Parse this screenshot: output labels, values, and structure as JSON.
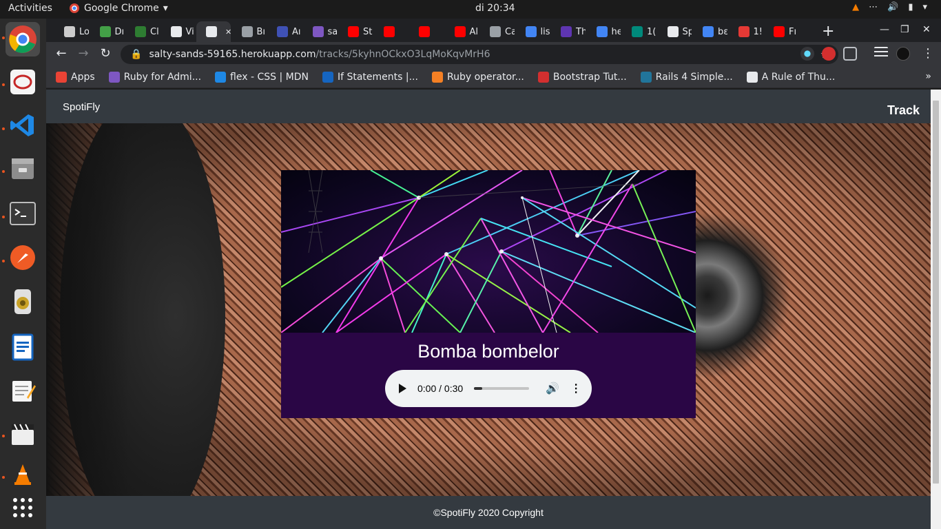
{
  "system": {
    "activities": "Activities",
    "app_name": "Google Chrome",
    "clock": "di 20:34"
  },
  "tabs": [
    {
      "label": "Lo",
      "color": "#cccccc"
    },
    {
      "label": "Dı",
      "color": "#43a047"
    },
    {
      "label": "Cl",
      "color": "#2e7d32"
    },
    {
      "label": "Vi",
      "color": "#e8eaed"
    },
    {
      "label": "",
      "color": "#e8eaed",
      "active": true
    },
    {
      "label": "Bı",
      "color": "#9aa0a6"
    },
    {
      "label": "Aı",
      "color": "#3f51b5"
    },
    {
      "label": "sa",
      "color": "#7e57c2"
    },
    {
      "label": "St",
      "color": "#ff0000"
    },
    {
      "label": "",
      "color": "#ff0000"
    },
    {
      "label": "",
      "color": "#ff0000"
    },
    {
      "label": "Al",
      "color": "#ff0000"
    },
    {
      "label": "Ca",
      "color": "#9aa0a6"
    },
    {
      "label": "lis",
      "color": "#4285f4"
    },
    {
      "label": "Th",
      "color": "#5e35b1"
    },
    {
      "label": "he",
      "color": "#4285f4"
    },
    {
      "label": "1(",
      "color": "#00897b"
    },
    {
      "label": "Sp",
      "color": "#e8eaed"
    },
    {
      "label": "bε",
      "color": "#4285f4"
    },
    {
      "label": "1!",
      "color": "#e53935"
    },
    {
      "label": "Fı",
      "color": "#ff0000"
    }
  ],
  "address": {
    "host": "salty-sands-59165.herokuapp.com",
    "path": "/tracks/5kyhnOCkxO3LqMoKqvMrH6"
  },
  "bookmarks": [
    {
      "label": "Apps",
      "color": "#ea4335"
    },
    {
      "label": "Ruby for Admi...",
      "color": "#7e57c2"
    },
    {
      "label": "flex - CSS | MDN",
      "color": "#1e88e5"
    },
    {
      "label": "If Statements |...",
      "color": "#1565c0"
    },
    {
      "label": "Ruby operator...",
      "color": "#f48024"
    },
    {
      "label": "Bootstrap Tut...",
      "color": "#d32f2f"
    },
    {
      "label": "Rails 4 Simple...",
      "color": "#21759b"
    },
    {
      "label": "A Rule of Thu...",
      "color": "#e8eaed"
    }
  ],
  "site": {
    "brand": "SpotiFly",
    "nav_title": "Track",
    "track_title": "Bomba bombelor",
    "footer": "©SpotiFly 2020 Copyright"
  },
  "player": {
    "time": "0:00 / 0:30",
    "progress": 0.15
  }
}
